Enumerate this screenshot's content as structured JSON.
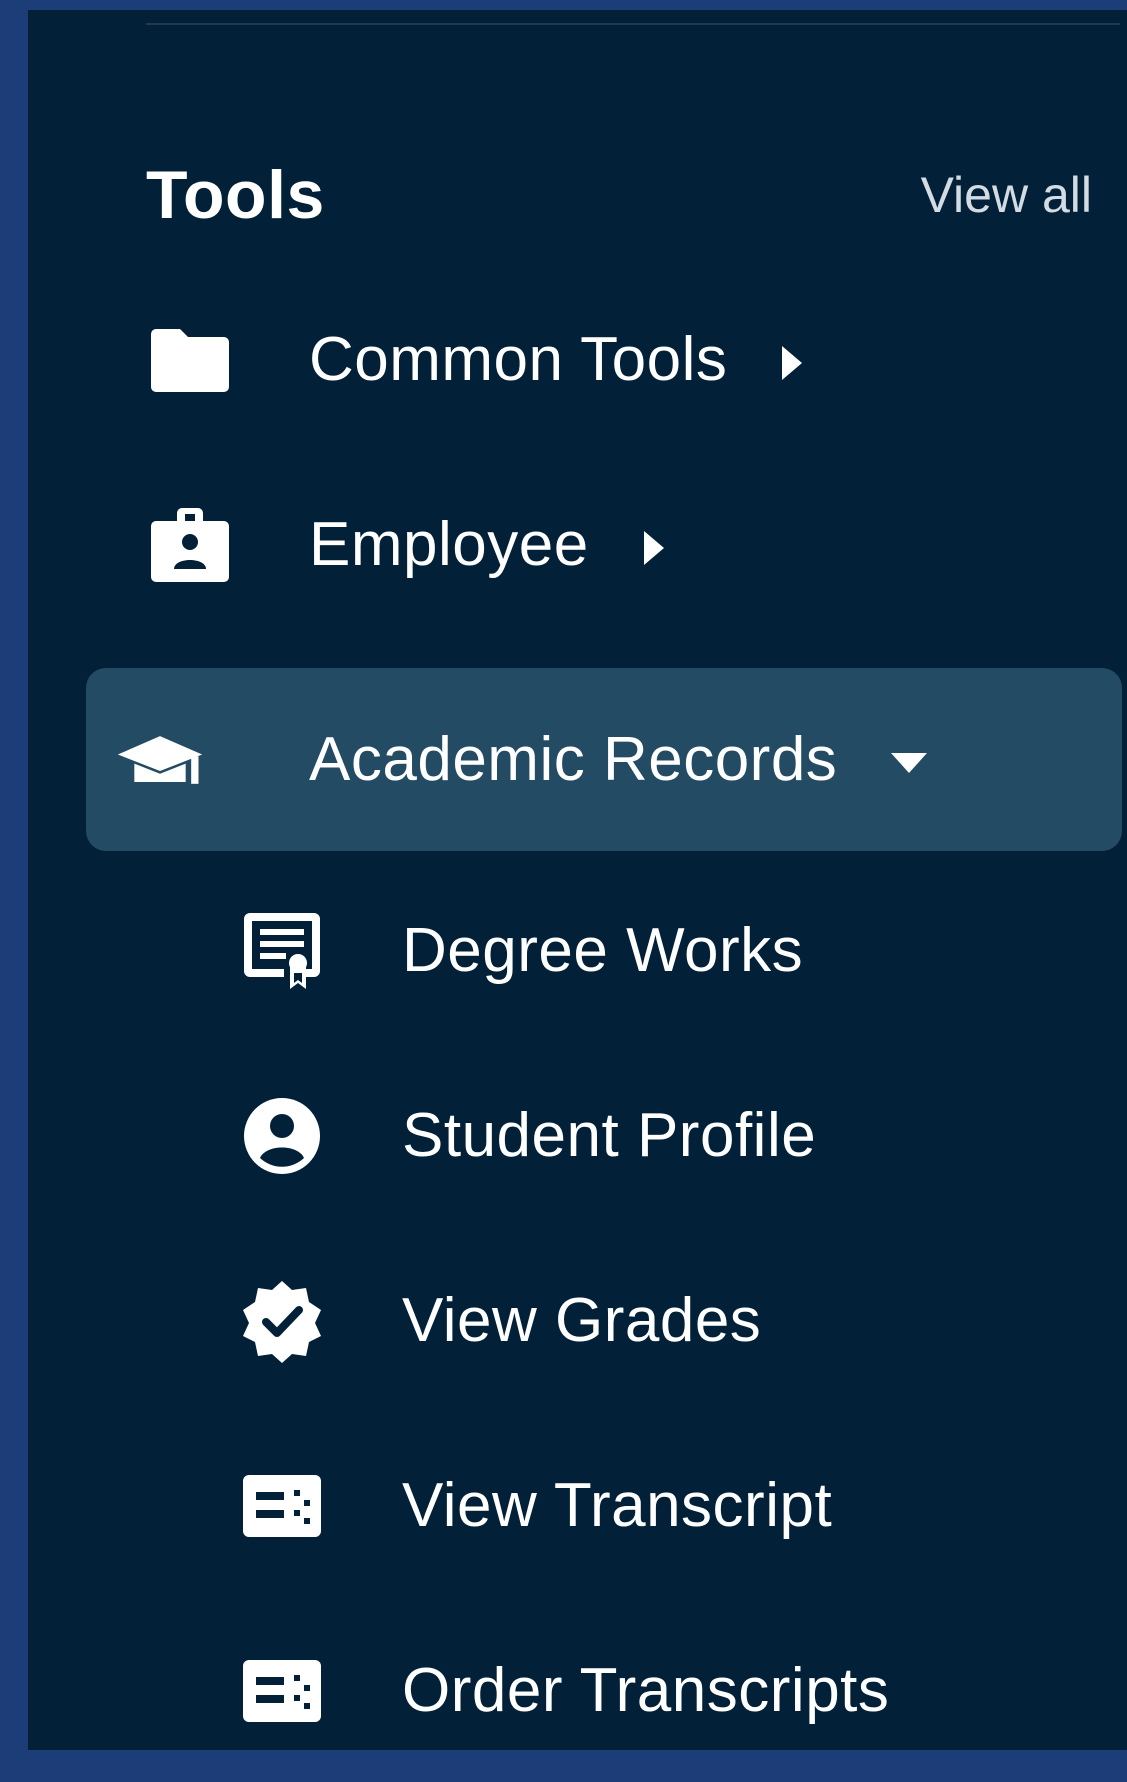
{
  "header": {
    "title": "Tools",
    "view_all": "View all"
  },
  "menu": {
    "items": [
      {
        "label": "Common Tools",
        "icon": "folder-icon",
        "caret": "caret-right-icon",
        "expanded": false
      },
      {
        "label": "Employee",
        "icon": "badge-icon",
        "caret": "caret-right-icon",
        "expanded": false
      },
      {
        "label": "Academic Records",
        "icon": "graduation-cap-icon",
        "caret": "caret-down-icon",
        "expanded": true,
        "children": [
          {
            "label": "Degree Works",
            "icon": "certificate-icon"
          },
          {
            "label": "Student Profile",
            "icon": "account-circle-icon"
          },
          {
            "label": "View Grades",
            "icon": "verified-badge-icon"
          },
          {
            "label": "View Transcript",
            "icon": "transcript-icon"
          },
          {
            "label": "Order Transcripts",
            "icon": "transcript-icon"
          }
        ]
      }
    ]
  },
  "colors": {
    "outer_background": "#1c3d78",
    "panel_background": "#022139",
    "active_item_background": "#234b63",
    "text": "#ffffff",
    "secondary_text": "#d3dbe3"
  }
}
